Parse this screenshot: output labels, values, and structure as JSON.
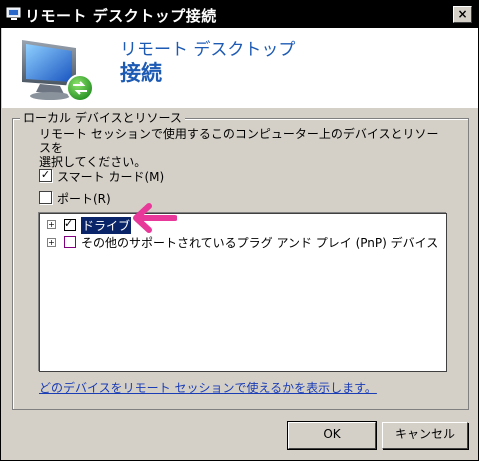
{
  "window": {
    "title": "リモート デスクトップ接続",
    "close_glyph": "×"
  },
  "header": {
    "line1": "リモート デスクトップ",
    "line2": "接続"
  },
  "group": {
    "label": "ローカル デバイスとリソース",
    "description": "リモート セッションで使用するこのコンピューター上のデバイスとリソースを\n選択してください。"
  },
  "options": {
    "smartcard": {
      "label": "スマート カード(M)",
      "checked": true
    },
    "ports": {
      "label": "ポート(R)",
      "checked": false
    }
  },
  "tree": {
    "items": [
      {
        "label": "ドライブ",
        "checked": true,
        "selected": true,
        "expander": "+"
      },
      {
        "label": "その他のサポートされているプラグ アンド プレイ (PnP) デバイス",
        "checked": false,
        "selected": false,
        "expander": "+"
      }
    ]
  },
  "link": {
    "text": "どのデバイスをリモート セッションで使えるかを表示します。"
  },
  "buttons": {
    "ok": "OK",
    "cancel": "キャンセル"
  },
  "colors": {
    "title_bg": "#000000",
    "header_text": "#1c5ab4",
    "selection": "#0a246a",
    "annotation_arrow": "#e8399a"
  },
  "icons": {
    "title": "remote-desktop-icon",
    "header": "monitor-connection-icon",
    "check": "✓"
  }
}
